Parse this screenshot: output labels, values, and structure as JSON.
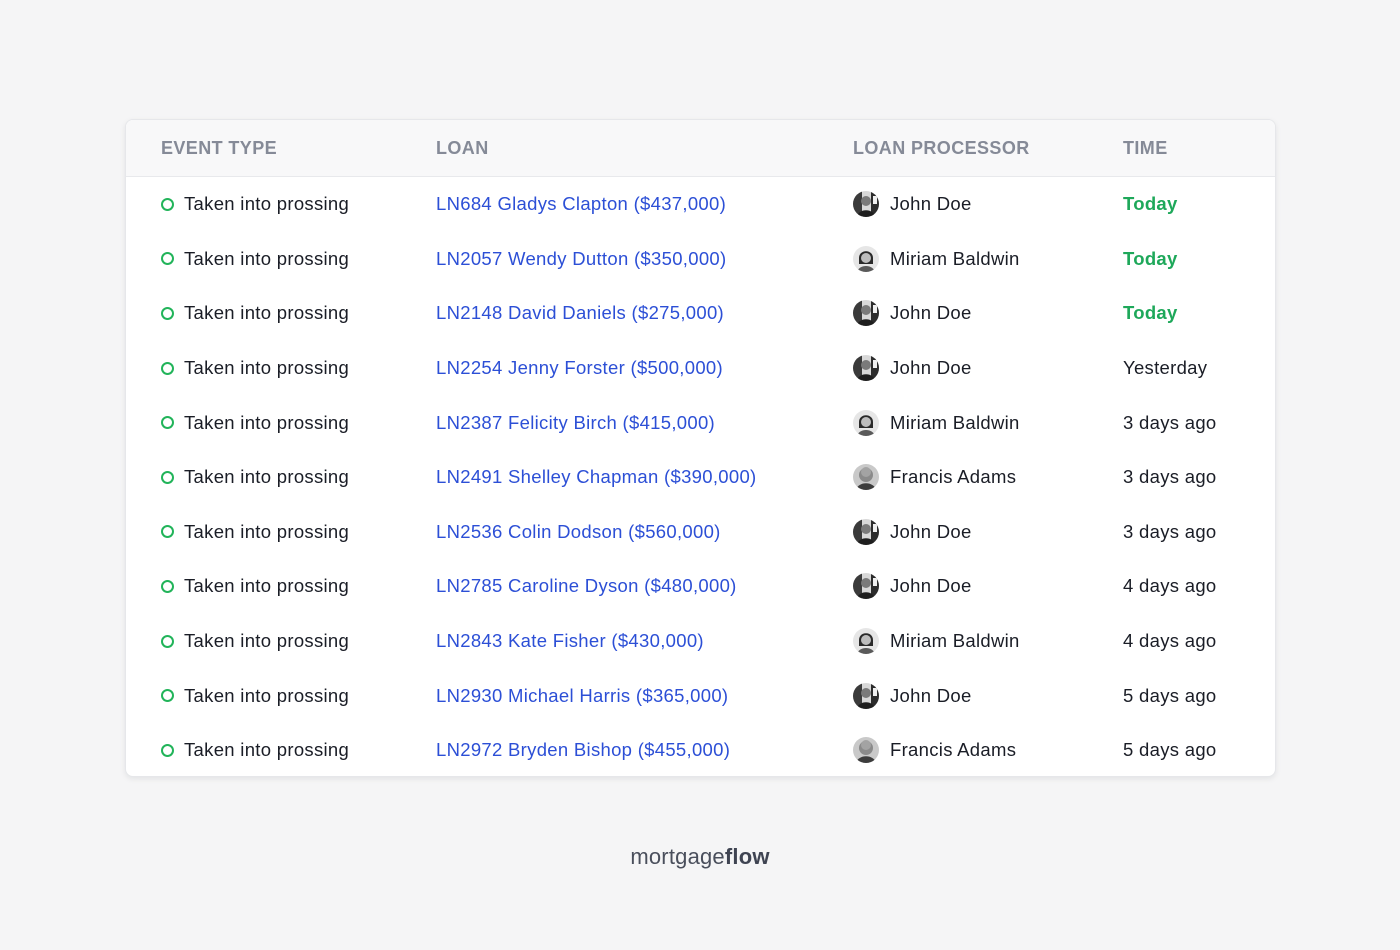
{
  "table": {
    "headers": {
      "event_type": "EVENT TYPE",
      "loan": "LOAN",
      "loan_processor": "LOAN PROCESSOR",
      "time": "TIME"
    },
    "rows": [
      {
        "event": "Taken into prossing",
        "loan": "LN684 Gladys Clapton ($437,000)",
        "processor": "John Doe",
        "avatar": "john-doe",
        "time": "Today",
        "time_highlight": true
      },
      {
        "event": "Taken into prossing",
        "loan": "LN2057 Wendy Dutton ($350,000)",
        "processor": "Miriam Baldwin",
        "avatar": "miriam-baldwin",
        "time": "Today",
        "time_highlight": true
      },
      {
        "event": "Taken into prossing",
        "loan": "LN2148 David Daniels ($275,000)",
        "processor": "John Doe",
        "avatar": "john-doe",
        "time": "Today",
        "time_highlight": true
      },
      {
        "event": "Taken into prossing",
        "loan": "LN2254 Jenny Forster ($500,000)",
        "processor": "John Doe",
        "avatar": "john-doe",
        "time": "Yesterday",
        "time_highlight": false
      },
      {
        "event": "Taken into prossing",
        "loan": "LN2387 Felicity Birch ($415,000)",
        "processor": "Miriam Baldwin",
        "avatar": "miriam-baldwin",
        "time": "3 days ago",
        "time_highlight": false
      },
      {
        "event": "Taken into prossing",
        "loan": "LN2491 Shelley Chapman ($390,000)",
        "processor": "Francis Adams",
        "avatar": "francis-adams",
        "time": "3 days ago",
        "time_highlight": false
      },
      {
        "event": "Taken into prossing",
        "loan": "LN2536 Colin Dodson ($560,000)",
        "processor": "John Doe",
        "avatar": "john-doe",
        "time": "3 days ago",
        "time_highlight": false
      },
      {
        "event": "Taken into prossing",
        "loan": "LN2785 Caroline Dyson ($480,000)",
        "processor": "John Doe",
        "avatar": "john-doe",
        "time": "4 days ago",
        "time_highlight": false
      },
      {
        "event": "Taken into prossing",
        "loan": "LN2843 Kate Fisher ($430,000)",
        "processor": "Miriam Baldwin",
        "avatar": "miriam-baldwin",
        "time": "4 days ago",
        "time_highlight": false
      },
      {
        "event": "Taken into prossing",
        "loan": "LN2930 Michael Harris ($365,000)",
        "processor": "John Doe",
        "avatar": "john-doe",
        "time": "5 days ago",
        "time_highlight": false
      },
      {
        "event": "Taken into prossing",
        "loan": "LN2972 Bryden Bishop ($455,000)",
        "processor": "Francis Adams",
        "avatar": "francis-adams",
        "time": "5 days ago",
        "time_highlight": false
      }
    ]
  },
  "brand": {
    "light": "mortgage",
    "bold": "flow"
  },
  "colors": {
    "status_dot": "#22b45a",
    "link": "#2c4fd6",
    "time_highlight": "#1ea85a",
    "header_text": "#858a97",
    "background": "#f5f5f6"
  },
  "icons": {
    "status": "status-circle-icon"
  }
}
